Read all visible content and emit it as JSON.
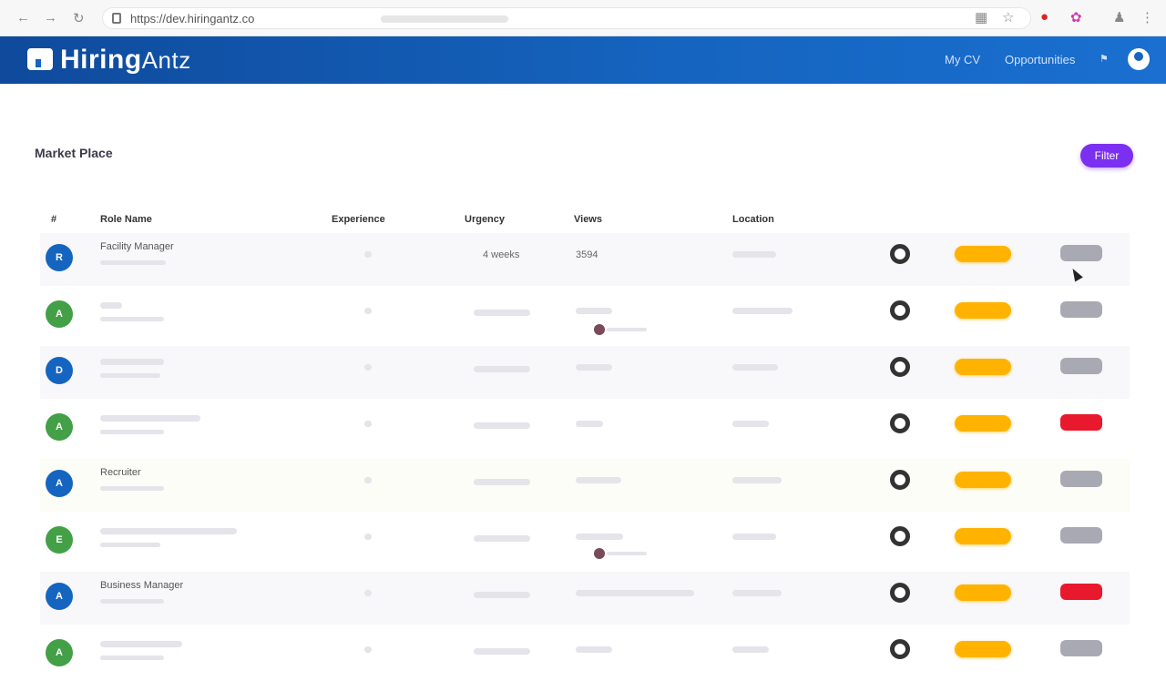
{
  "browser": {
    "url": "https://dev.hiringantz.co",
    "back_icon": "arrow-left",
    "forward_icon": "arrow-right",
    "reload_icon": "reload"
  },
  "header": {
    "logo_bold": "Hiring",
    "logo_thin": "Antz",
    "nav": [
      "My CV",
      "Opportunities"
    ],
    "brand_color": "#1565c0"
  },
  "page": {
    "title": "Market Place",
    "filter_label": "Filter",
    "accent_color": "#7b2ff0"
  },
  "table": {
    "headers": [
      "#",
      "Role Name",
      "Experience",
      "Urgency",
      "Views",
      "Location"
    ],
    "rows": [
      {
        "badge": "R",
        "badge_color": "blue",
        "role": "Facility Manager",
        "sub": "",
        "exp": "",
        "urgency": "4 weeks",
        "views": "3594",
        "location": "",
        "status": "grey"
      },
      {
        "badge": "A",
        "badge_color": "green",
        "role": "",
        "sub": "",
        "exp": "",
        "urgency": "",
        "views": "",
        "location": "",
        "status": "grey"
      },
      {
        "badge": "D",
        "badge_color": "blue",
        "role": "",
        "sub": "",
        "exp": "",
        "urgency": "",
        "views": "",
        "location": "",
        "status": "grey"
      },
      {
        "badge": "A",
        "badge_color": "green",
        "role": "",
        "sub": "",
        "exp": "",
        "urgency": "",
        "views": "",
        "location": "",
        "status": "red"
      },
      {
        "badge": "A",
        "badge_color": "blue",
        "role": "Recruiter",
        "sub": "",
        "exp": "",
        "urgency": "",
        "views": "",
        "location": "",
        "status": "grey"
      },
      {
        "badge": "E",
        "badge_color": "green",
        "role": "",
        "sub": "",
        "exp": "",
        "urgency": "",
        "views": "",
        "location": "",
        "status": "grey"
      },
      {
        "badge": "A",
        "badge_color": "blue",
        "role": "Business Manager",
        "sub": "",
        "exp": "",
        "urgency": "",
        "views": "",
        "location": "",
        "status": "red"
      },
      {
        "badge": "A",
        "badge_color": "green",
        "role": "",
        "sub": "",
        "exp": "",
        "urgency": "",
        "views": "",
        "location": "",
        "status": "grey"
      }
    ]
  },
  "colors": {
    "apply_pill": "#ffb300",
    "status_grey": "#a9a9b3",
    "status_red": "#e8192c"
  }
}
